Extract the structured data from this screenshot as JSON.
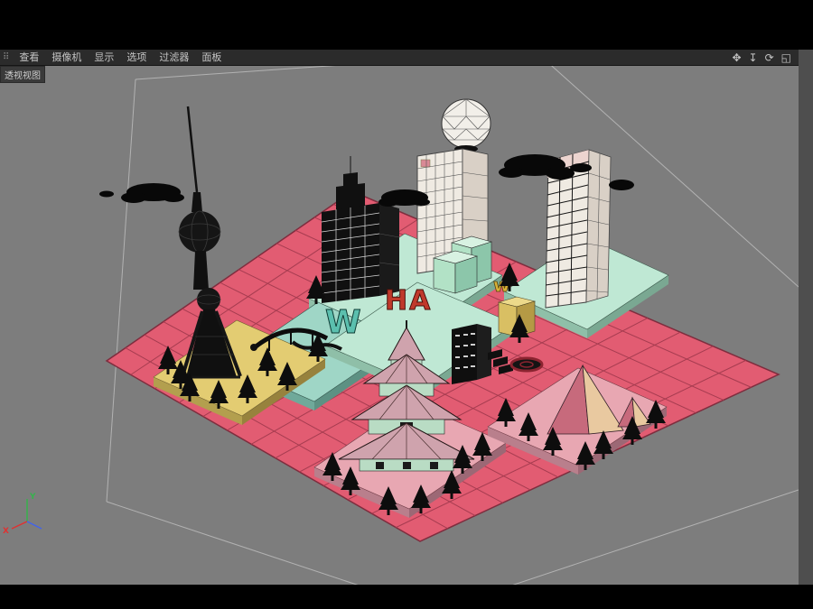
{
  "window": {
    "viewport_label": "透视视图"
  },
  "menu": {
    "grip_glyph": "⠿",
    "items": [
      "查看",
      "摄像机",
      "显示",
      "选项",
      "过滤器",
      "面板"
    ]
  },
  "toolbar": {
    "icons": [
      {
        "name": "pan-view-icon",
        "glyph": "✥"
      },
      {
        "name": "zoom-view-icon",
        "glyph": "↧"
      },
      {
        "name": "rotate-view-icon",
        "glyph": "⟳"
      },
      {
        "name": "toggle-view-icon",
        "glyph": "◱"
      }
    ]
  },
  "scene": {
    "description": "low-poly 3D city model on pink grid ground plane, perspective view",
    "ground": {
      "divisions": 13,
      "corners": {
        "n": [
          390,
          139
        ],
        "e": [
          862,
          342
        ],
        "s": [
          465,
          527
        ],
        "w": [
          118,
          327
        ]
      }
    },
    "letters": [
      "W",
      "HA",
      "w"
    ],
    "landmarks": [
      "oriental-pearl-tower",
      "geodesic-dome-building",
      "dark-grid-skyscraper",
      "tall-window-building",
      "pagoda",
      "pyramid",
      "bridge",
      "round-plaza"
    ]
  },
  "axis_gizmo": {
    "x_label": "X",
    "y_label": "Y"
  },
  "colors": {
    "chrome_black": "#000000",
    "menubar_bg": "#2b2b2b",
    "menu_text": "#c4c4c4",
    "strip": "#4e4e4e",
    "label_bg": "#3a3a3a",
    "viewport_bg": "#7d7d7d",
    "ground_pink": "#e25c72",
    "ground_grid": "#a63c50",
    "ground_edge": "#7e2d3e",
    "tile_mint": "#bfe8d4",
    "tile_mint_side": "#8fbfa8",
    "tile_teal": "#9fd6c6",
    "tile_teal_side": "#6fa99a",
    "tile_yellow": "#e3cc72",
    "tile_yellow_side": "#b39f4e",
    "tile_pink": "#e8a7b2",
    "tile_pink_side": "#b97f8c",
    "dark": "#101010",
    "building_white": "#efeae2",
    "building_white_side": "#d9d0c6",
    "roof_pink": "#cfa3ad",
    "wall_green": "#b9dcc4",
    "letter_teal": "#5bbfae",
    "letter_red": "#c0392b",
    "letter_yellow": "#d9b23a",
    "pyramid_left": "#c76a7c",
    "pyramid_right": "#e9c9a0",
    "axis_x": "#e03131",
    "axis_y": "#37b24d",
    "axis_z": "#4263eb"
  }
}
